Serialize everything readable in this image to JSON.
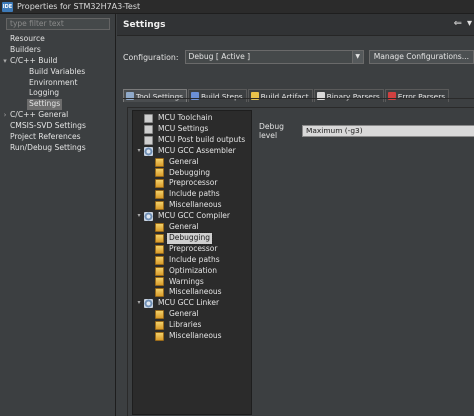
{
  "window": {
    "icon_text": "IDE",
    "title": "Properties for STM32H7A3-Test"
  },
  "sidebar": {
    "filter_placeholder": "type filter text",
    "items": [
      {
        "label": "Resource",
        "level": 0,
        "twisty": ""
      },
      {
        "label": "Builders",
        "level": 0,
        "twisty": ""
      },
      {
        "label": "C/C++ Build",
        "level": 0,
        "twisty": "▾"
      },
      {
        "label": "Build Variables",
        "level": 1,
        "twisty": ""
      },
      {
        "label": "Environment",
        "level": 1,
        "twisty": ""
      },
      {
        "label": "Logging",
        "level": 1,
        "twisty": ""
      },
      {
        "label": "Settings",
        "level": 1,
        "twisty": "",
        "selected": true
      },
      {
        "label": "C/C++ General",
        "level": 0,
        "twisty": "›"
      },
      {
        "label": "CMSIS-SVD Settings",
        "level": 0,
        "twisty": ""
      },
      {
        "label": "Project References",
        "level": 0,
        "twisty": ""
      },
      {
        "label": "Run/Debug Settings",
        "level": 0,
        "twisty": ""
      }
    ]
  },
  "header": {
    "title": "Settings",
    "back_icon": "⇐",
    "forward_icon": "▾"
  },
  "configuration": {
    "label": "Configuration:",
    "value": "Debug  [ Active ]",
    "manage_label": "Manage Configurations..."
  },
  "tabs": [
    {
      "label": "Tool Settings",
      "icon": "tool-settings-icon",
      "color": "#8fa9c9",
      "active": true
    },
    {
      "label": "Build Steps",
      "icon": "build-steps-icon",
      "color": "#6b8fd6"
    },
    {
      "label": "Build Artifact",
      "icon": "build-artifact-icon",
      "color": "#e8c24a"
    },
    {
      "label": "Binary Parsers",
      "icon": "binary-parsers-icon",
      "color": "#d8d8d8"
    },
    {
      "label": "Error Parsers",
      "icon": "error-parsers-icon",
      "color": "#d04040"
    }
  ],
  "tool_tree": [
    {
      "label": "MCU Toolchain",
      "level": 0,
      "icon": "page",
      "twisty": ""
    },
    {
      "label": "MCU Settings",
      "level": 0,
      "icon": "page",
      "twisty": ""
    },
    {
      "label": "MCU Post build outputs",
      "level": 0,
      "icon": "page",
      "twisty": ""
    },
    {
      "label": "MCU GCC Assembler",
      "level": 0,
      "icon": "gear",
      "twisty": "▾"
    },
    {
      "label": "General",
      "level": 1,
      "icon": "folder",
      "twisty": ""
    },
    {
      "label": "Debugging",
      "level": 1,
      "icon": "folder",
      "twisty": ""
    },
    {
      "label": "Preprocessor",
      "level": 1,
      "icon": "folder",
      "twisty": ""
    },
    {
      "label": "Include paths",
      "level": 1,
      "icon": "folder",
      "twisty": ""
    },
    {
      "label": "Miscellaneous",
      "level": 1,
      "icon": "folder",
      "twisty": ""
    },
    {
      "label": "MCU GCC Compiler",
      "level": 0,
      "icon": "gear",
      "twisty": "▾"
    },
    {
      "label": "General",
      "level": 1,
      "icon": "folder",
      "twisty": ""
    },
    {
      "label": "Debugging",
      "level": 1,
      "icon": "folder",
      "twisty": "",
      "selected": true
    },
    {
      "label": "Preprocessor",
      "level": 1,
      "icon": "folder",
      "twisty": ""
    },
    {
      "label": "Include paths",
      "level": 1,
      "icon": "folder",
      "twisty": ""
    },
    {
      "label": "Optimization",
      "level": 1,
      "icon": "folder",
      "twisty": ""
    },
    {
      "label": "Warnings",
      "level": 1,
      "icon": "folder",
      "twisty": ""
    },
    {
      "label": "Miscellaneous",
      "level": 1,
      "icon": "folder",
      "twisty": ""
    },
    {
      "label": "MCU GCC Linker",
      "level": 0,
      "icon": "gear",
      "twisty": "▾"
    },
    {
      "label": "General",
      "level": 1,
      "icon": "folder",
      "twisty": ""
    },
    {
      "label": "Libraries",
      "level": 1,
      "icon": "folder",
      "twisty": ""
    },
    {
      "label": "Miscellaneous",
      "level": 1,
      "icon": "folder",
      "twisty": ""
    }
  ],
  "debug_level": {
    "label": "Debug level",
    "value": "Maximum (-g3)"
  }
}
